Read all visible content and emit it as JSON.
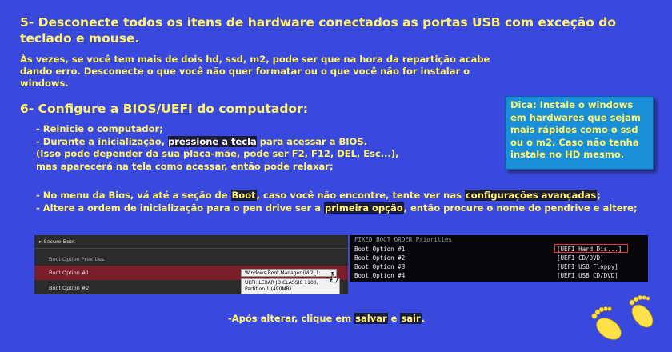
{
  "step5": {
    "title": "5- Desconecte todos os itens de hardware conectados as portas USB com exceção do teclado e mouse.",
    "body": "Às vezes, se você tem mais de dois hd, ssd, m2, pode ser que na hora da repartição acabe dando erro. Desconecte o que você não quer formatar ou o que você não for instalar o windows."
  },
  "step6": {
    "title": "6- Configure a BIOS/UEFI do computador:",
    "l1": "- Reinicie o computador;",
    "l2a": "- Durante a inicialização, ",
    "l2b": "pressione a tecla",
    "l2c": " para acessar a BIOS.",
    "l3": "(Isso pode depender da sua placa-mãe, pode ser F2, F12, DEL, Esc...),",
    "l4": "mas aparecerá na tela como acessar, então pode relaxar;",
    "l5a": "- No menu da Bios, vá até a seção de ",
    "l5b": "Boot",
    "l5c": ", caso você não encontre, tente ver nas ",
    "l5d": "configurações avançadas",
    "l5e": ";",
    "l6a": "- Altere a ordem de inicialização para o pen drive ser a ",
    "l6b": "primeira opção",
    "l6c": ", então procure o nome do pendrive e altere;"
  },
  "tip": "Dica: Instale o windows em hardwares que sejam mais rápidos como o ssd ou o m2. Caso não tenha instale no HD mesmo.",
  "bios_left": {
    "secure_boot": "Secure Boot",
    "priorities": "Boot Option Priorities",
    "opt1": "Boot Option #1",
    "opt2": "Boot Option #2",
    "dropdown": "Windows Boot Manager (M.2_1:",
    "popup": "UEFI: LEXAR JD CLASSIC 1100, Partition 1 (490MB)"
  },
  "bios_right": {
    "header": "FIXED BOOT ORDER Priorities",
    "rows": [
      {
        "label": "Boot Option #1",
        "value": "[UEFI Hard Dis...]"
      },
      {
        "label": "Boot Option #2",
        "value": "[UEFI CD/DVD]"
      },
      {
        "label": "Boot Option #3",
        "value": "[UEFI USB Floppy]"
      },
      {
        "label": "Boot Option #4",
        "value": "[UEFI USB CD/DVD]"
      }
    ]
  },
  "final": {
    "a": "-Após alterar, clique em ",
    "b": "salvar",
    "c": " e ",
    "d": "sair",
    "e": "."
  },
  "colors": {
    "background": "#3a49dd",
    "text": "#fff36a",
    "tip_box": "#1a8fd8"
  }
}
